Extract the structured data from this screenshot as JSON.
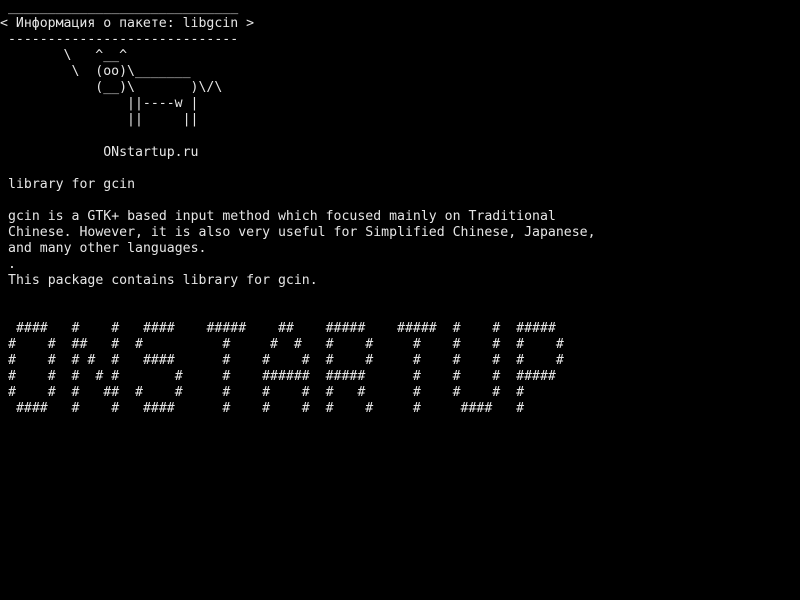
{
  "terminal": {
    "cowsay": {
      "top_border": " _____________________________",
      "message": "< Информация о пакете: libgcin >",
      "bottom_border": " -----------------------------",
      "cow": [
        "        \\   ^__^",
        "         \\  (oo)\\_______",
        "            (__)\\       )\\/\\",
        "                ||----w |",
        "                ||     ||"
      ],
      "site": "             ONstartup.ru"
    },
    "summary": "library for gcin",
    "description": [
      "gcin is a GTK+ based input method which focused mainly on Traditional",
      "Chinese. However, it is also very useful for Simplified Chinese, Japanese,",
      "and many other languages.",
      ".",
      "This package contains library for gcin."
    ],
    "banner": [
      " ####   #    #   ####    #####    ##    #####    #####  #    #  #####",
      "#    #  ##   #  #          #     #  #   #    #     #    #    #  #    #",
      "#    #  # #  #   ####      #    #    #  #    #     #    #    #  #    #",
      "#    #  #  # #       #     #    ######  #####      #    #    #  #####",
      "#    #  #   ##  #    #     #    #    #  #   #      #    #    #  #",
      " ####   #    #   ####      #    #    #  #    #     #     ####   #"
    ],
    "colors": {
      "background": "#000000",
      "foreground": "#e6e6e6"
    }
  }
}
